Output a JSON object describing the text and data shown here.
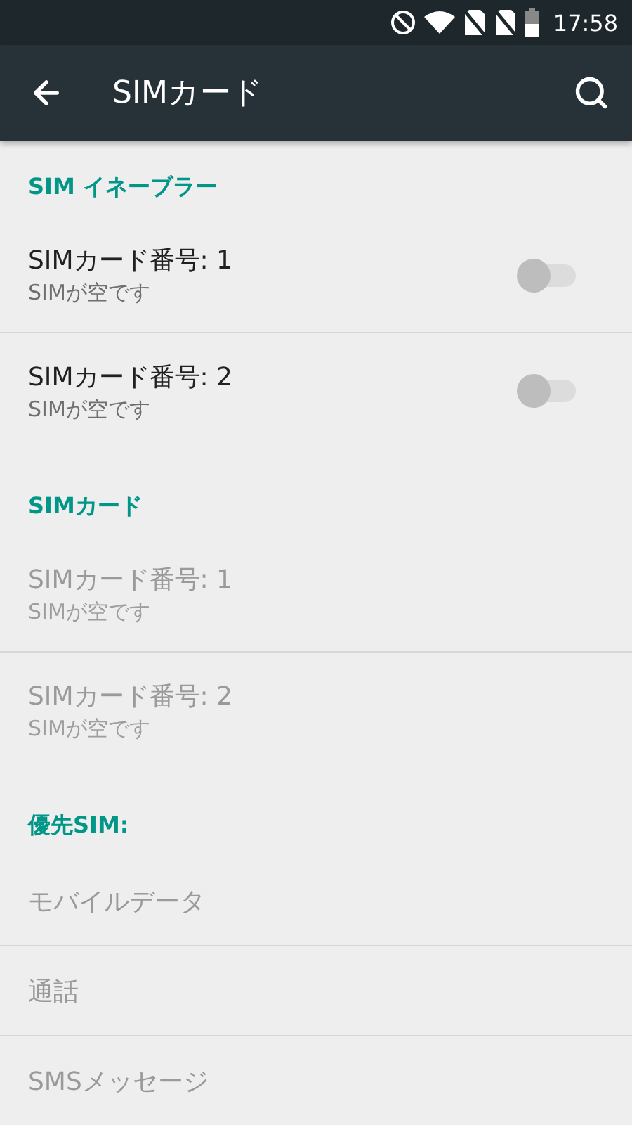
{
  "status_bar": {
    "time": "17:58"
  },
  "app_bar": {
    "title": "SIMカード"
  },
  "sections": [
    {
      "header": "SIM イネーブラー",
      "items": [
        {
          "kind": "switch",
          "title": "SIMカード番号: 1",
          "subtitle": "SIMが空です",
          "on": false,
          "disabled": false
        },
        {
          "kind": "switch",
          "title": "SIMカード番号: 2",
          "subtitle": "SIMが空です",
          "on": false,
          "disabled": false
        }
      ]
    },
    {
      "header": "SIMカード",
      "items": [
        {
          "kind": "plain",
          "title": "SIMカード番号: 1",
          "subtitle": "SIMが空です",
          "disabled": true
        },
        {
          "kind": "plain",
          "title": "SIMカード番号: 2",
          "subtitle": "SIMが空です",
          "disabled": true
        }
      ]
    },
    {
      "header": "優先SIM:",
      "items": [
        {
          "kind": "plain",
          "title": "モバイルデータ",
          "disabled": true
        },
        {
          "kind": "plain",
          "title": "通話",
          "disabled": true
        },
        {
          "kind": "plain",
          "title": "SMSメッセージ",
          "disabled": true
        }
      ]
    }
  ]
}
